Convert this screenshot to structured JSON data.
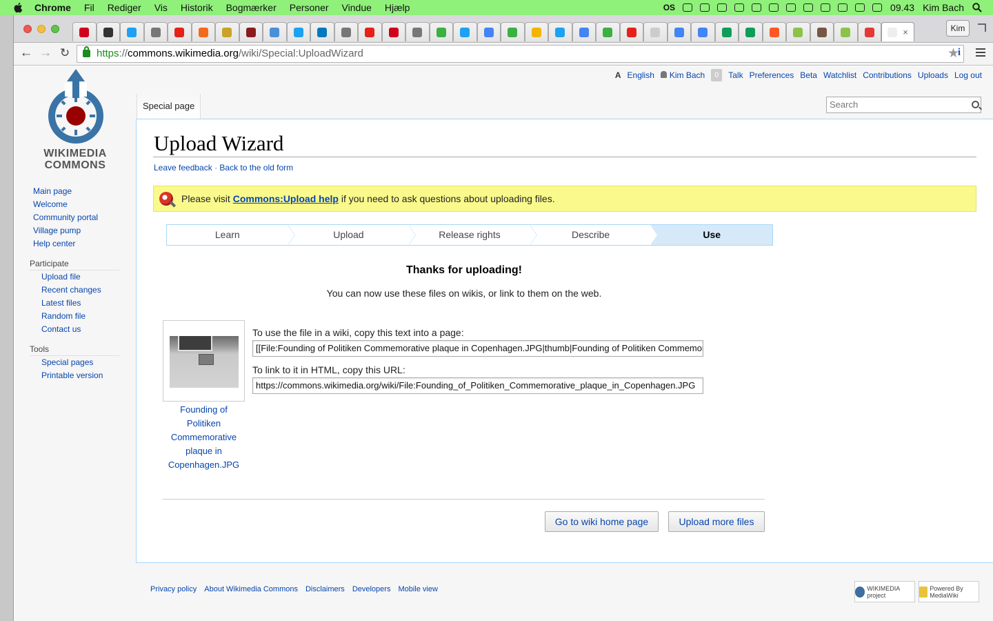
{
  "menubar": {
    "items": [
      "Chrome",
      "Fil",
      "Rediger",
      "Vis",
      "Historik",
      "Bogmærker",
      "Personer",
      "Vindue",
      "Hjælp"
    ],
    "tray_os": "OS",
    "clock": "09.43",
    "user": "Kim Bach"
  },
  "browser": {
    "profile": "Kim",
    "url_scheme": "https",
    "url_sep": "://",
    "url_host": "commons.wikimedia.org",
    "url_path": "/wiki/Special:UploadWizard",
    "close_tab": "×"
  },
  "personal": {
    "language": "English",
    "lang_icon": "A",
    "user": "Kim Bach",
    "notifications": "0",
    "links": [
      "Talk",
      "Preferences",
      "Beta",
      "Watchlist",
      "Contributions",
      "Uploads",
      "Log out"
    ]
  },
  "logo": {
    "line1": "WIKIMEDIA",
    "line2": "COMMONS"
  },
  "sidebar": {
    "nav": [
      "Main page",
      "Welcome",
      "Community portal",
      "Village pump",
      "Help center"
    ],
    "participate_title": "Participate",
    "participate": [
      "Upload file",
      "Recent changes",
      "Latest files",
      "Random file",
      "Contact us"
    ],
    "tools_title": "Tools",
    "tools": [
      "Special pages",
      "Printable version"
    ]
  },
  "tabs": {
    "special": "Special page"
  },
  "search": {
    "placeholder": "Search"
  },
  "content": {
    "title": "Upload Wizard",
    "feedback_link": "Leave feedback",
    "separator": " · ",
    "old_form_link": "Back to the old form",
    "notice_pre": "Please visit ",
    "notice_link": "Commons:Upload help",
    "notice_post": " if you need to ask questions about uploading files.",
    "steps": [
      "Learn",
      "Upload",
      "Release rights",
      "Describe",
      "Use"
    ],
    "current_step": "Use",
    "thanks_heading": "Thanks for uploading!",
    "thanks_sub": "You can now use these files on wikis, or link to them on the web.",
    "thumb_caption": "Founding of Politiken Commemorative plaque in Copenhagen.JPG",
    "wiki_label": "To use the file in a wiki, copy this text into a page:",
    "wiki_value": "[[File:Founding of Politiken Commemorative plaque in Copenhagen.JPG|thumb|Founding of Politiken Commemorative plaque in Copenhagen]]",
    "html_label": "To link to it in HTML, copy this URL:",
    "html_value": "https://commons.wikimedia.org/wiki/File:Founding_of_Politiken_Commemorative_plaque_in_Copenhagen.JPG",
    "home_button": "Go to wiki home page",
    "more_button": "Upload more files"
  },
  "footer": {
    "links": [
      "Privacy policy",
      "About Wikimedia Commons",
      "Disclaimers",
      "Developers",
      "Mobile view"
    ],
    "wmf_badge": "WIKIMEDIA project",
    "mw_badge": "Powered By MediaWiki"
  },
  "colors": {
    "menubar": "#8ff07a",
    "link": "#0645ad",
    "notice": "#fafa8c",
    "step_current": "#d6e9f9",
    "logo_blue": "#3a74a6",
    "logo_red": "#990000"
  }
}
